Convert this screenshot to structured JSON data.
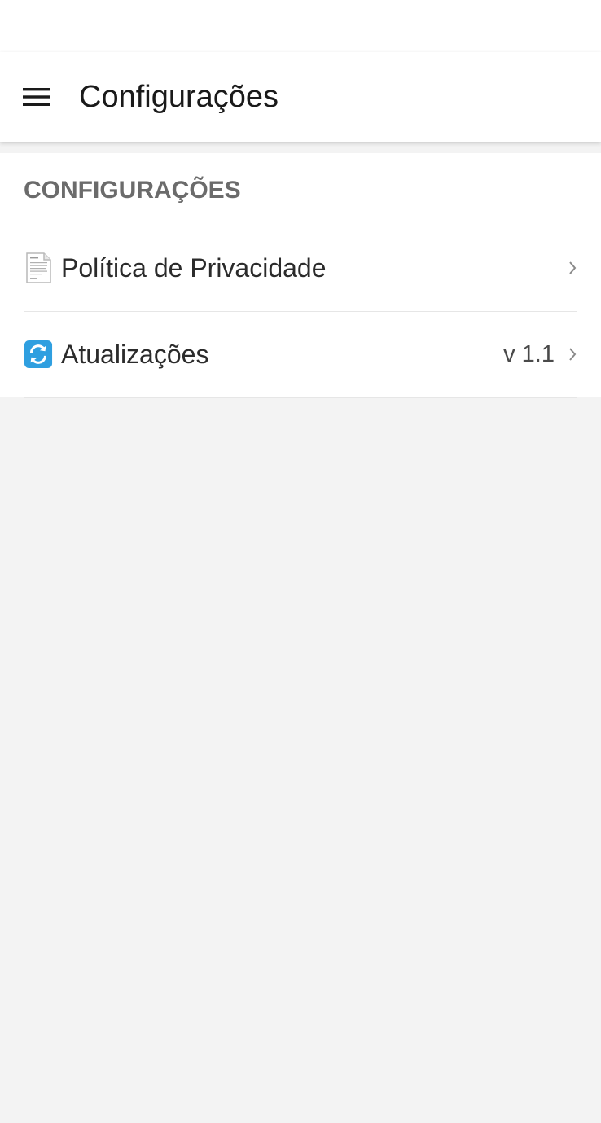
{
  "app_bar": {
    "title": "Configurações",
    "menu_icon": "hamburger-menu-icon"
  },
  "section": {
    "header": "CONFIGURAÇÕES"
  },
  "items": [
    {
      "label": "Política de Privacidade",
      "icon": "document-icon",
      "value": "",
      "chevron_icon": "chevron-right-icon"
    },
    {
      "label": "Atualizações",
      "icon": "refresh-icon",
      "value": "v 1.1",
      "chevron_icon": "chevron-right-icon"
    }
  ],
  "colors": {
    "app_bar_background": "#ffffff",
    "page_background": "#f3f3f3",
    "title_text": "#1a1a1a",
    "section_header_text": "#6b6b6b",
    "refresh_icon_blue": "#2f9fe0"
  }
}
